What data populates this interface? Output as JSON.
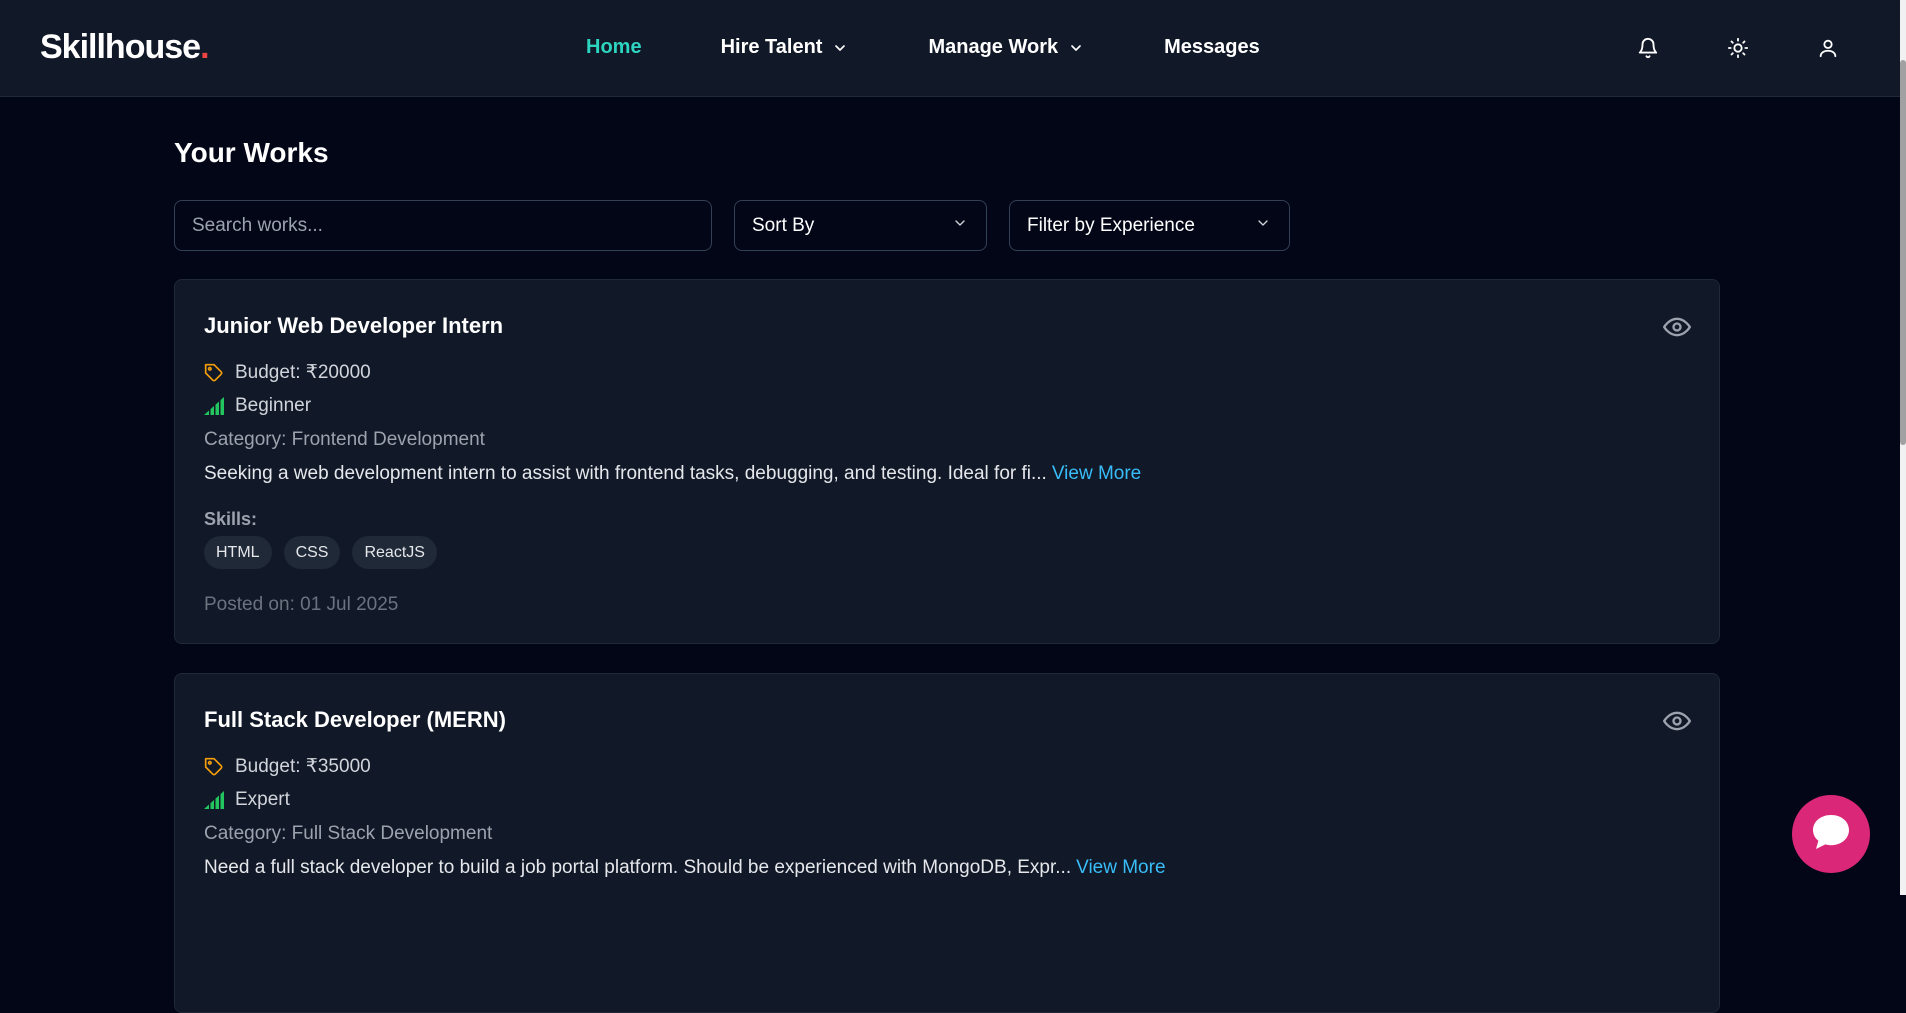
{
  "colors": {
    "nav_bg": "#111827",
    "page_bg": "#020617",
    "accent_active": "#2dd4bf",
    "link": "#38bdf8",
    "logo_dot": "#ef4444",
    "fab": "#db2777",
    "level_icon": "#22c55e",
    "budget_icon": "#f59e0b"
  },
  "nav": {
    "logo_text": "Skillhouse",
    "logo_dot": ".",
    "links": [
      {
        "label": "Home",
        "active": true
      },
      {
        "label": "Hire Talent",
        "dropdown": true
      },
      {
        "label": "Manage Work",
        "dropdown": true
      },
      {
        "label": "Messages"
      }
    ],
    "icons": [
      "bell-icon",
      "sun-icon",
      "user-icon"
    ]
  },
  "main": {
    "title": "Your Works",
    "search_placeholder": "Search works...",
    "sort_label": "Sort By",
    "experience_label": "Filter by Experience"
  },
  "works": [
    {
      "title": "Junior Web Developer Intern",
      "budget": "Budget: ₹20000",
      "level": "Beginner",
      "category": "Category: Frontend Development",
      "description": "Seeking a web development intern to assist with frontend tasks, debugging, and testing. Ideal for fi...",
      "view_more": "View More",
      "skills_label": "Skills:",
      "skills": [
        "HTML",
        "CSS",
        "ReactJS"
      ],
      "posted": "Posted on: 01 Jul 2025"
    },
    {
      "title": "Full Stack Developer (MERN)",
      "budget": "Budget: ₹35000",
      "level": "Expert",
      "category": "Category: Full Stack Development",
      "description": "Need a full stack developer to build a job portal platform. Should be experienced with MongoDB, Expr...",
      "view_more": "View More"
    }
  ]
}
